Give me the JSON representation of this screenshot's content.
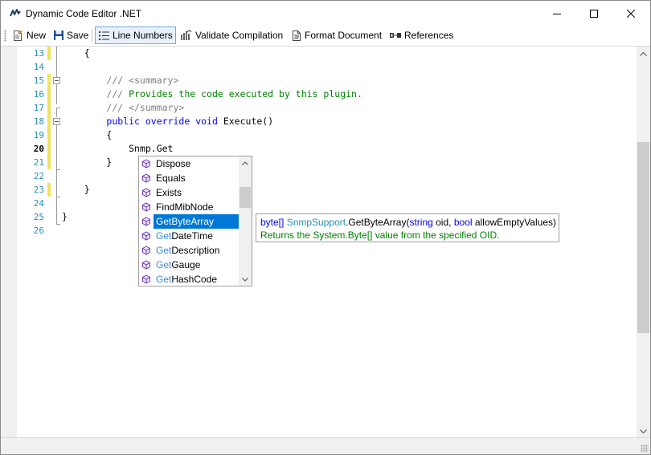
{
  "window": {
    "title": "Dynamic Code Editor .NET"
  },
  "toolbar": {
    "new_label": "New",
    "save_label": "Save",
    "line_numbers_label": "Line Numbers",
    "validate_label": "Validate Compilation",
    "format_label": "Format Document",
    "references_label": "References"
  },
  "editor": {
    "lines": [
      {
        "num": "13",
        "code": "    {"
      },
      {
        "num": "14",
        "code": ""
      },
      {
        "num": "15",
        "code": "        /// <summary>"
      },
      {
        "num": "16",
        "code": "        /// Provides the code executed by this plugin."
      },
      {
        "num": "17",
        "code": "        /// </summary>"
      },
      {
        "num": "18",
        "code": "        public override void Execute()"
      },
      {
        "num": "19",
        "code": "        {"
      },
      {
        "num": "20",
        "code": "            Snmp.Get"
      },
      {
        "num": "21",
        "code": "        }"
      },
      {
        "num": "22",
        "code": ""
      },
      {
        "num": "23",
        "code": "    }"
      },
      {
        "num": "24",
        "code": ""
      },
      {
        "num": "25",
        "code": "}"
      },
      {
        "num": "26",
        "code": ""
      }
    ],
    "current_line": "20"
  },
  "completion": {
    "items": [
      {
        "prefix": "",
        "rest": "Dispose"
      },
      {
        "prefix": "",
        "rest": "Equals"
      },
      {
        "prefix": "",
        "rest": "Exists"
      },
      {
        "prefix": "",
        "rest": "FindMibNode"
      },
      {
        "prefix": "Get",
        "rest": "ByteArray"
      },
      {
        "prefix": "Get",
        "rest": "DateTime"
      },
      {
        "prefix": "Get",
        "rest": "Description"
      },
      {
        "prefix": "Get",
        "rest": "Gauge"
      },
      {
        "prefix": "Get",
        "rest": "HashCode"
      }
    ],
    "selected_index": 4,
    "icon": "method-cube-icon"
  },
  "tooltip": {
    "sig_type": "byte[]",
    "sig_class": "SnmpSupport",
    "sig_method": ".GetByteArray(",
    "sig_kw1": "string",
    "sig_p1": " oid, ",
    "sig_kw2": "bool",
    "sig_p2": " allowEmptyValues)",
    "doc": "Returns the System.Byte[] value from the specified OID."
  },
  "status": {
    "text": ""
  },
  "colors": {
    "accent": "#0078d7",
    "line_number": "#2b91af",
    "keyword": "#0000ff",
    "comment": "#008000",
    "change_marker": "#f3e35b"
  }
}
